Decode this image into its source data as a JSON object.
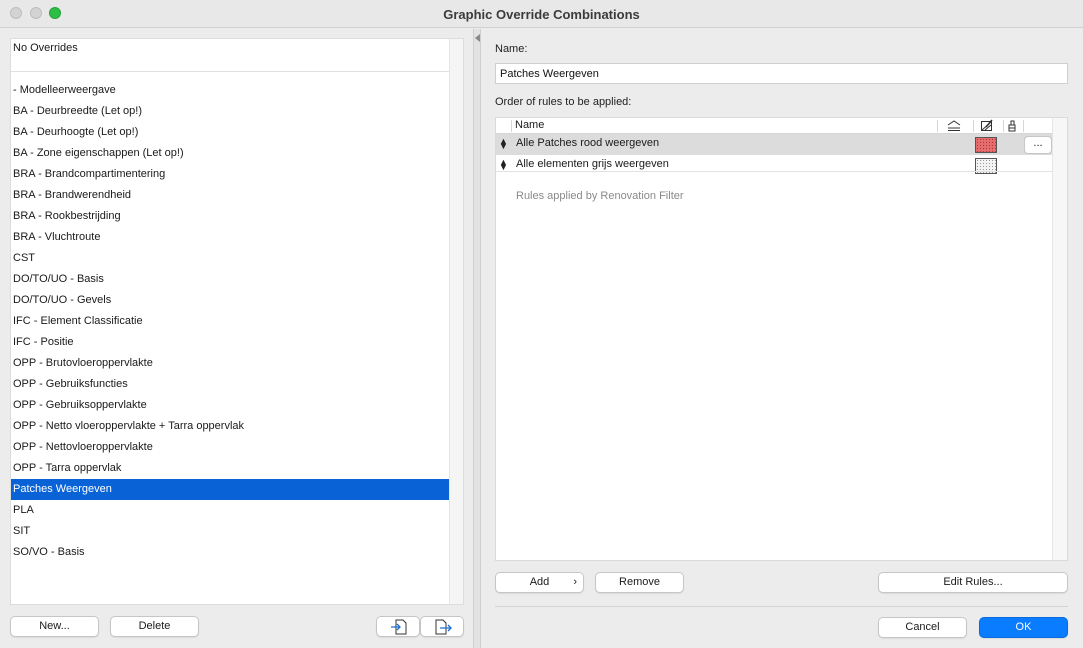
{
  "window": {
    "title": "Graphic Override Combinations"
  },
  "left": {
    "no_overrides": "No Overrides",
    "items": [
      "- Modelleerweergave",
      "BA - Deurbreedte (Let op!)",
      "BA - Deurhoogte (Let op!)",
      "BA - Zone eigenschappen (Let op!)",
      "BRA - Brandcompartimentering",
      "BRA - Brandwerendheid",
      "BRA - Rookbestrijding",
      "BRA - Vluchtroute",
      "CST",
      "DO/TO/UO - Basis",
      "DO/TO/UO - Gevels",
      "IFC - Element Classificatie",
      "IFC - Positie",
      "OPP - Brutovloeroppervlakte",
      "OPP - Gebruiksfuncties",
      "OPP - Gebruiksoppervlakte",
      "OPP - Netto vloeroppervlakte + Tarra oppervlak",
      "OPP - Nettovloeroppervlakte",
      "OPP - Tarra oppervlak",
      "Patches Weergeven",
      "PLA",
      "SIT",
      "SO/VO - Basis"
    ],
    "selected_index": 19,
    "new_label": "New...",
    "delete_label": "Delete"
  },
  "right": {
    "name_label": "Name:",
    "name_value": "Patches Weergeven",
    "order_label": "Order of rules to be applied:",
    "column_name": "Name",
    "rules": [
      {
        "name": "Alle Patches rood weergeven",
        "swatch": "red"
      },
      {
        "name": "Alle elementen grijs weergeven",
        "swatch": "grey"
      }
    ],
    "more_label": "...",
    "renovation_text": "Rules applied by Renovation Filter",
    "add_label": "Add",
    "remove_label": "Remove",
    "edit_rules_label": "Edit Rules...",
    "cancel_label": "Cancel",
    "ok_label": "OK"
  },
  "colors": {
    "selection": "#0a63d6",
    "primary": "#0a7cff",
    "close": "#d3d3d3",
    "maximize": "#2dbf45"
  }
}
